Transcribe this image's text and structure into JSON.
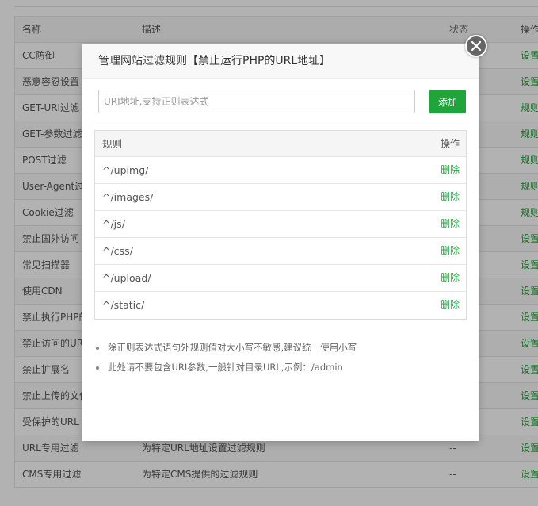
{
  "background_table": {
    "headers": {
      "name": "名称",
      "desc": "描述",
      "status": "状态",
      "op": "操作"
    },
    "rows": [
      {
        "name": "CC防御",
        "desc": "",
        "status": "",
        "op": "设置"
      },
      {
        "name": "恶意容忍设置",
        "desc": "",
        "status": "",
        "op": "设置"
      },
      {
        "name": "GET-URI过滤",
        "desc": "",
        "status": "",
        "op": "规则"
      },
      {
        "name": "GET-参数过滤",
        "desc": "",
        "status": "",
        "op": "规则"
      },
      {
        "name": "POST过滤",
        "desc": "",
        "status": "",
        "op": "规则"
      },
      {
        "name": "User-Agent过",
        "desc": "",
        "status": "",
        "op": "规则"
      },
      {
        "name": "Cookie过滤",
        "desc": "",
        "status": "",
        "op": "规则"
      },
      {
        "name": "禁止国外访问",
        "desc": "",
        "status": "",
        "op": "设置"
      },
      {
        "name": "常见扫描器",
        "desc": "",
        "status": "",
        "op": "设置"
      },
      {
        "name": "使用CDN",
        "desc": "",
        "status": "",
        "op": "设置"
      },
      {
        "name": "禁止执行PHP的",
        "desc": "",
        "status": "",
        "op": "设置"
      },
      {
        "name": "禁止访问的UR",
        "desc": "",
        "status": "",
        "op": "设置"
      },
      {
        "name": "禁止扩展名",
        "desc": "",
        "status": "",
        "op": "设置"
      },
      {
        "name": "禁止上传的文件",
        "desc": "",
        "status": "",
        "op": "设置"
      },
      {
        "name": "受保护的URL",
        "desc": "",
        "status": "",
        "op": "设置"
      },
      {
        "name": "URL专用过滤",
        "desc": "为特定URL地址设置过滤规则",
        "status": "--",
        "op": "设置"
      },
      {
        "name": "CMS专用过滤",
        "desc": "为特定CMS提供的过滤规则",
        "status": "--",
        "op": "设置"
      }
    ]
  },
  "modal": {
    "title": "管理网站过滤规则【禁止运行PHP的URL地址】",
    "input_placeholder": "URI地址,支持正则表达式",
    "add_label": "添加",
    "table_headers": {
      "rule": "规则",
      "op": "操作"
    },
    "rules": [
      {
        "rule": "^/upimg/",
        "op": "删除"
      },
      {
        "rule": "^/images/",
        "op": "删除"
      },
      {
        "rule": "^/js/",
        "op": "删除"
      },
      {
        "rule": "^/css/",
        "op": "删除"
      },
      {
        "rule": "^/upload/",
        "op": "删除"
      },
      {
        "rule": "^/static/",
        "op": "删除"
      }
    ],
    "tips": [
      "除正则表达式语句外规则值对大小写不敏感,建议统一使用小写",
      "此处请不要包含URI参数,一般针对目录URL,示例：/admin"
    ]
  },
  "colors": {
    "accent": "#20a53a",
    "close_bg": "#666666"
  },
  "icons": {
    "close": "close-icon"
  }
}
